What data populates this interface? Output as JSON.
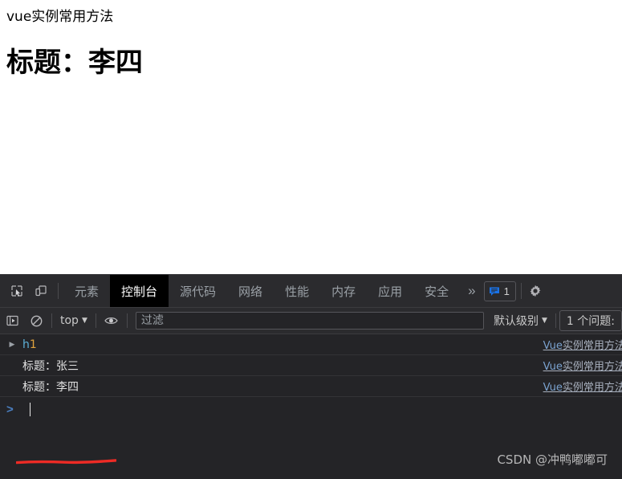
{
  "page": {
    "title_text": "vue实例常用方法",
    "heading": "标题：李四"
  },
  "devtools": {
    "icons": {
      "inspect": "inspect-element-icon",
      "device": "device-toolbar-icon",
      "settings": "gear-icon"
    },
    "tabs": [
      {
        "label": "元素",
        "name": "tab-elements",
        "active": false
      },
      {
        "label": "控制台",
        "name": "tab-console",
        "active": true
      },
      {
        "label": "源代码",
        "name": "tab-sources",
        "active": false
      },
      {
        "label": "网络",
        "name": "tab-network",
        "active": false
      },
      {
        "label": "性能",
        "name": "tab-performance",
        "active": false
      },
      {
        "label": "内存",
        "name": "tab-memory",
        "active": false
      },
      {
        "label": "应用",
        "name": "tab-application",
        "active": false
      },
      {
        "label": "安全",
        "name": "tab-security",
        "active": false
      }
    ],
    "more_tabs_label": "»",
    "message_count": "1",
    "console_toolbar": {
      "context_label": "top",
      "context_caret": "▼",
      "filter_placeholder": "过滤",
      "filter_value": "",
      "level_label": "默认级别",
      "level_caret": "▼",
      "issues_label": "1 个问题:"
    },
    "messages": [
      {
        "expander": "▶",
        "text": "h1",
        "is_node": true,
        "node_tag": "h",
        "node_num": "1",
        "source": "Vue实例常用方法."
      },
      {
        "expander": "",
        "text": "标题：张三",
        "is_node": false,
        "source": "Vue实例常用方法."
      },
      {
        "expander": "",
        "text": "标题：李四",
        "is_node": false,
        "source": "Vue实例常用方法."
      }
    ],
    "prompt_symbol": ">",
    "prompt_value": ""
  },
  "watermark": "CSDN @冲鸭嘟嘟可",
  "colors": {
    "devtools_bg": "#242427",
    "toolbar_bg": "#2b2b2e",
    "active_tab_bg": "#000000",
    "accent_blue": "#1a73e8",
    "annotation_red": "#ee2b25",
    "node_tag": "#5db0d7",
    "node_num": "#e0a33e"
  }
}
